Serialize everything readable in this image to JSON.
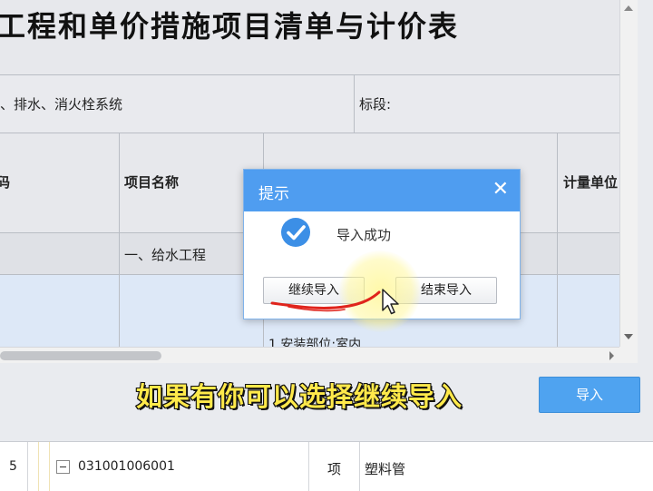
{
  "sheet": {
    "title": "工程和单价措施项目清单与计价表",
    "project_name": "、排水、消火栓系统",
    "section_label": "标段:",
    "col_header_partial_left": "码",
    "col_header_name": "项目名称",
    "col_header_unit_partial": "计量单位",
    "group_row": "一、给水工程",
    "desc_partial": "1 安装部位:室内"
  },
  "dialog": {
    "title": "提示",
    "close_glyph": "✕",
    "message": "导入成功",
    "continue_label": "继续导入",
    "finish_label": "结束导入"
  },
  "import_button": "导入",
  "caption": "如果有你可以选择继续导入",
  "list_row": {
    "index": "5",
    "expand_glyph": "−",
    "code": "031001006001",
    "unit": "项",
    "name": "塑料管"
  },
  "colors": {
    "dialog_header": "#4f9df0",
    "import_button": "#4fa3f0",
    "caption_text": "#ffe94a",
    "pen_mark": "#e0241c"
  }
}
